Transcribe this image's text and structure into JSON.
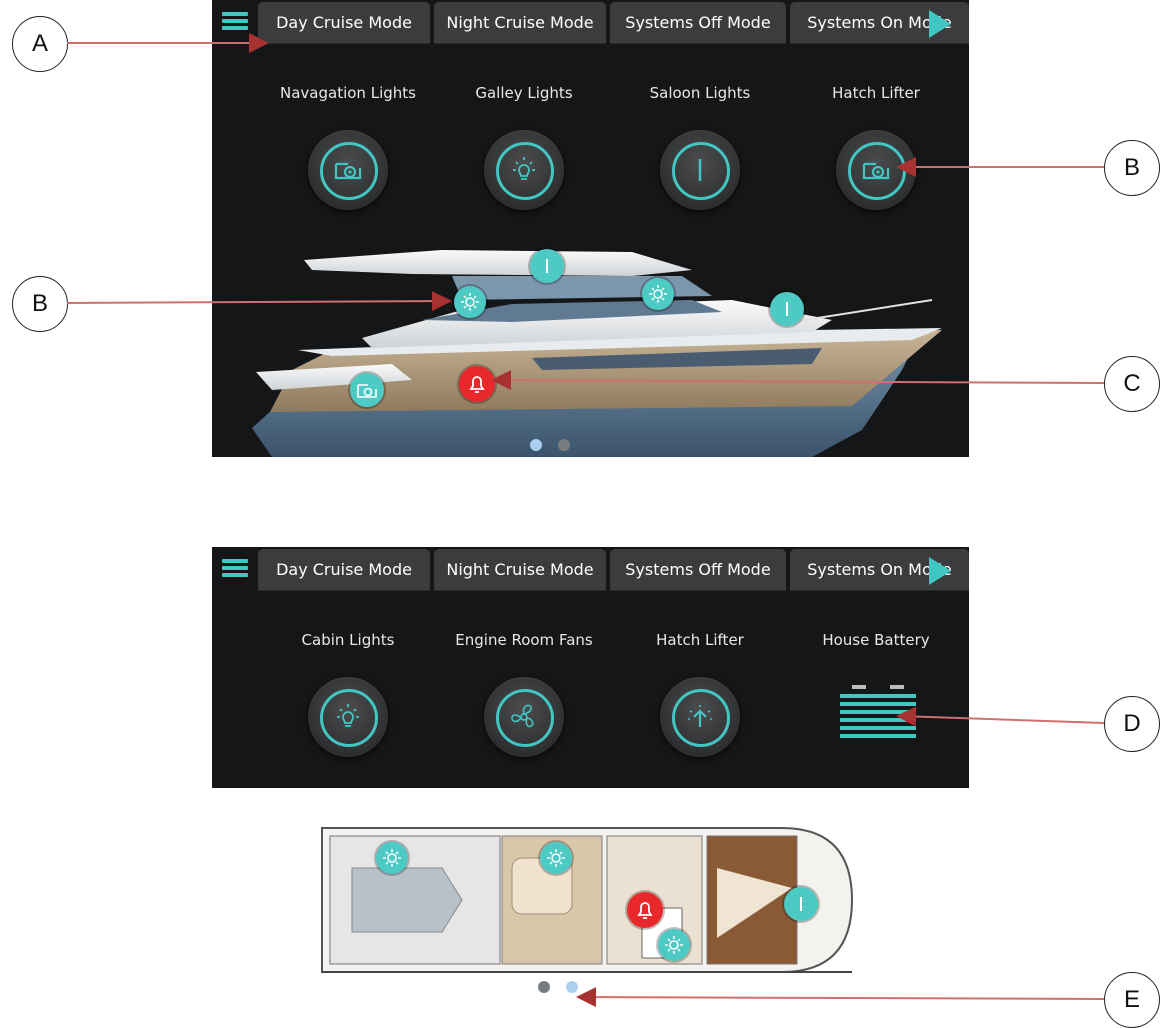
{
  "tabs": [
    "Day Cruise Mode",
    "Night Cruise Mode",
    "Systems Off Mode",
    "Systems On Mode"
  ],
  "screen1": {
    "controls": [
      {
        "label": "Navagation Lights",
        "icon": "hatch-lifter-icon"
      },
      {
        "label": "Galley Lights",
        "icon": "light-bulb-icon"
      },
      {
        "label": "Saloon Lights",
        "icon": "power-icon"
      },
      {
        "label": "Hatch Lifter",
        "icon": "hatch-lifter-icon"
      }
    ],
    "page_indicator": {
      "pages": 2,
      "active": 1
    }
  },
  "screen2": {
    "controls": [
      {
        "label": "Cabin Lights",
        "icon": "light-bulb-icon"
      },
      {
        "label": "Engine Room Fans",
        "icon": "fan-icon"
      },
      {
        "label": "Hatch Lifter",
        "icon": "hatch-up-icon"
      },
      {
        "label": "House Battery",
        "icon": "battery-icon"
      }
    ],
    "page_indicator": {
      "pages": 2,
      "active": 2
    }
  },
  "callouts": [
    "A",
    "B",
    "B",
    "C",
    "D",
    "E"
  ],
  "colors": {
    "accent": "#41c6c1",
    "alarm": "#e8282b",
    "background": "#151617",
    "tab": "#3a3c3e",
    "annotation": "#c0504d"
  }
}
